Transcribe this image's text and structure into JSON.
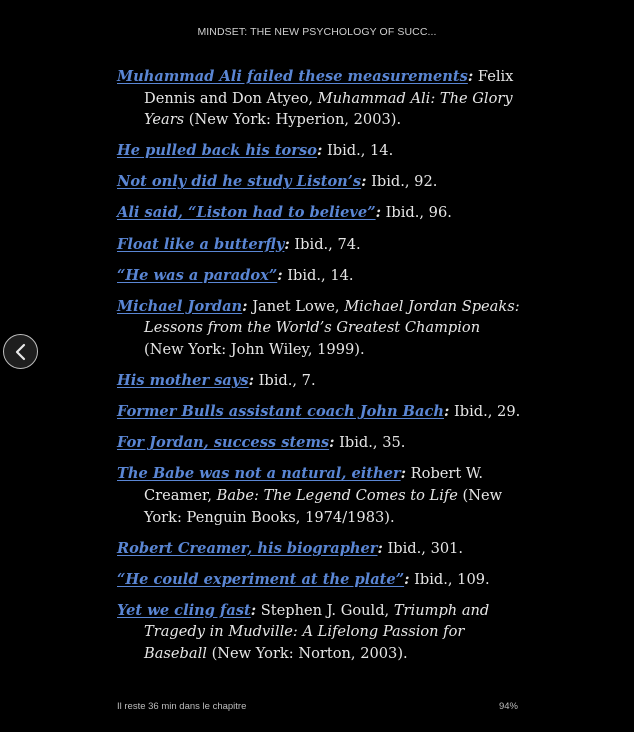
{
  "header": {
    "title": "MINDSET: THE NEW PSYCHOLOGY OF SUCC..."
  },
  "nav": {
    "back_icon": "chevron-left-icon"
  },
  "notes": [
    {
      "link": "Muhammad Ali failed these measurements",
      "pre": " Felix Dennis and Don Atyeo, ",
      "title": "Muhammad Ali: The Glory Years",
      "post": " (New York: Hyperion, 2003)."
    },
    {
      "link": "He pulled back his torso",
      "pre": " Ibid., 14.",
      "title": "",
      "post": ""
    },
    {
      "link": "Not only did he study Liston’s",
      "pre": " Ibid., 92.",
      "title": "",
      "post": ""
    },
    {
      "link": "Ali said, “Liston had to believe”",
      "pre": " Ibid., 96.",
      "title": "",
      "post": ""
    },
    {
      "link": "Float like a butterfly",
      "pre": " Ibid., 74.",
      "title": "",
      "post": ""
    },
    {
      "link": "“He was a paradox”",
      "pre": " Ibid., 14.",
      "title": "",
      "post": ""
    },
    {
      "link": "Michael Jordan",
      "pre": " Janet Lowe, ",
      "title": "Michael Jordan Speaks: Les­sons from the World’s Greatest Champion",
      "post": " (New York: John Wiley, 1999)."
    },
    {
      "link": "His mother says",
      "pre": " Ibid., 7.",
      "title": "",
      "post": ""
    },
    {
      "link": "Former Bulls assistant coach John Bach",
      "pre": " Ibid., 29.",
      "title": "",
      "post": ""
    },
    {
      "link": "For Jordan, success stems",
      "pre": " Ibid., 35.",
      "title": "",
      "post": ""
    },
    {
      "link": "The Babe was not a natural, either",
      "pre": " Robert W. Creamer, ",
      "title": "Babe: The Legend Comes to Life",
      "post": " (New York: Penguin Books, 1974/1983)."
    },
    {
      "link": "Robert Creamer, his biographer",
      "pre": " Ibid., 301.",
      "title": "",
      "post": ""
    },
    {
      "link": "“He could experiment at the plate”",
      "pre": " Ibid., 109.",
      "title": "",
      "post": ""
    },
    {
      "link": "Yet we cling fast",
      "pre": " Stephen J. Gould, ",
      "title": "Triumph and Tragedy in Mudville: A Lifelong Passion for Baseball",
      "post": " (New York: Norton, 2003)."
    }
  ],
  "footer": {
    "time_left": "Il reste 36 min dans le chapitre",
    "progress": "94%"
  },
  "colors": {
    "background": "#000000",
    "link": "#5a86d4",
    "text": "#e6e6e6"
  }
}
